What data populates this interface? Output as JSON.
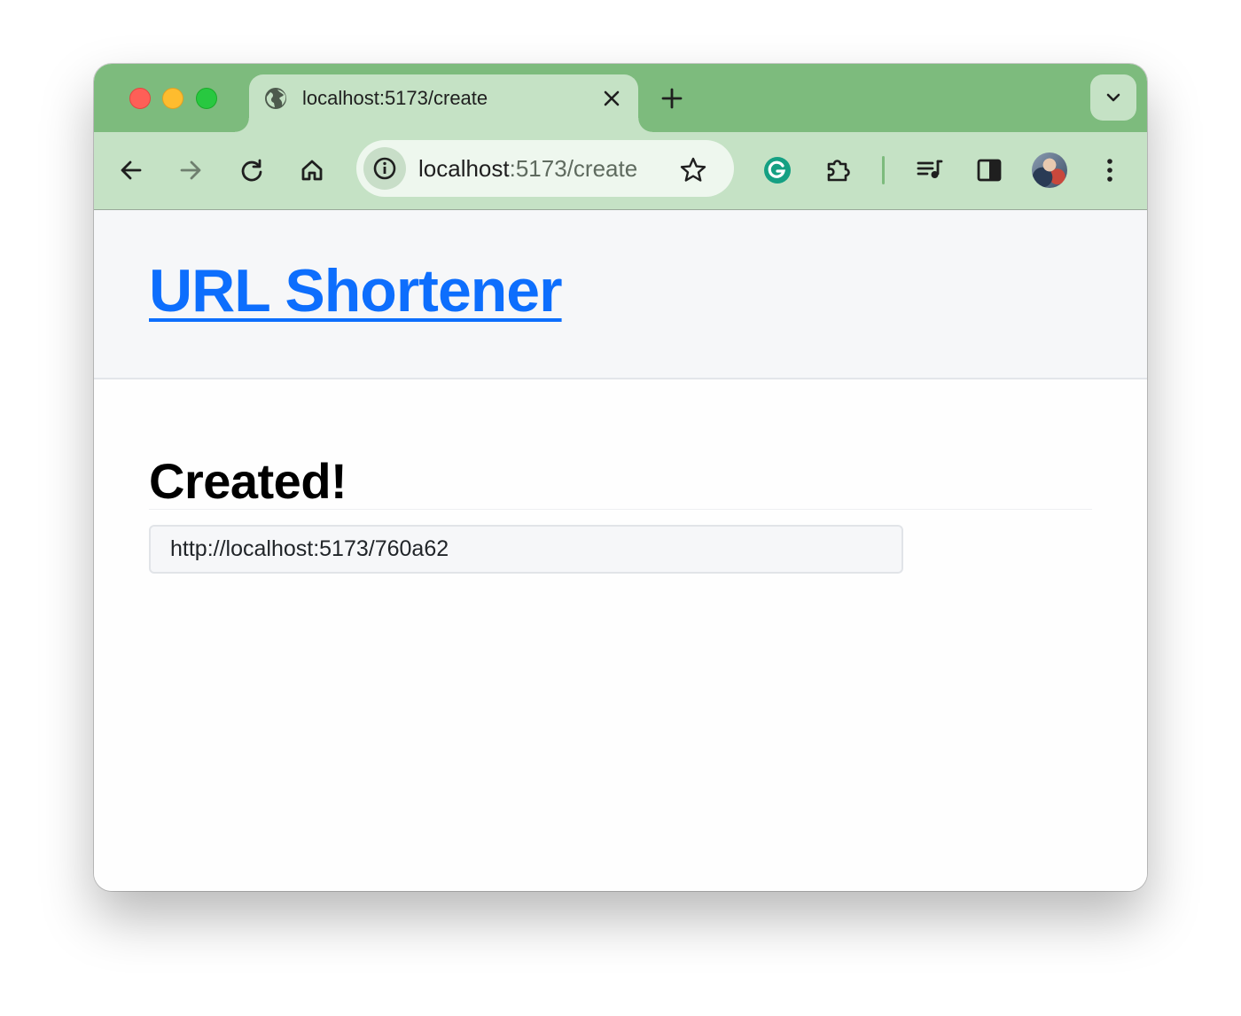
{
  "browser": {
    "tab": {
      "title": "localhost:5173/create",
      "favicon": "globe-icon"
    },
    "omnibox": {
      "host": "localhost",
      "path": ":5173/create"
    },
    "toolbar_icons": [
      "back-arrow-icon",
      "forward-arrow-icon",
      "reload-icon",
      "home-icon",
      "site-info-icon",
      "bookmark-star-icon",
      "grammarly-extension-icon",
      "extensions-puzzle-icon",
      "reading-list-icon",
      "side-panel-icon",
      "profile-avatar",
      "kebab-menu-icon"
    ],
    "colors": {
      "tabstrip": "#7dbb7d",
      "toolbar": "#c5e2c5"
    }
  },
  "page": {
    "site_title": "URL Shortener",
    "heading": "Created!",
    "short_url": "http://localhost:5173/760a62",
    "colors": {
      "link": "#0d6efd",
      "header_bg": "#f6f7f9"
    }
  }
}
